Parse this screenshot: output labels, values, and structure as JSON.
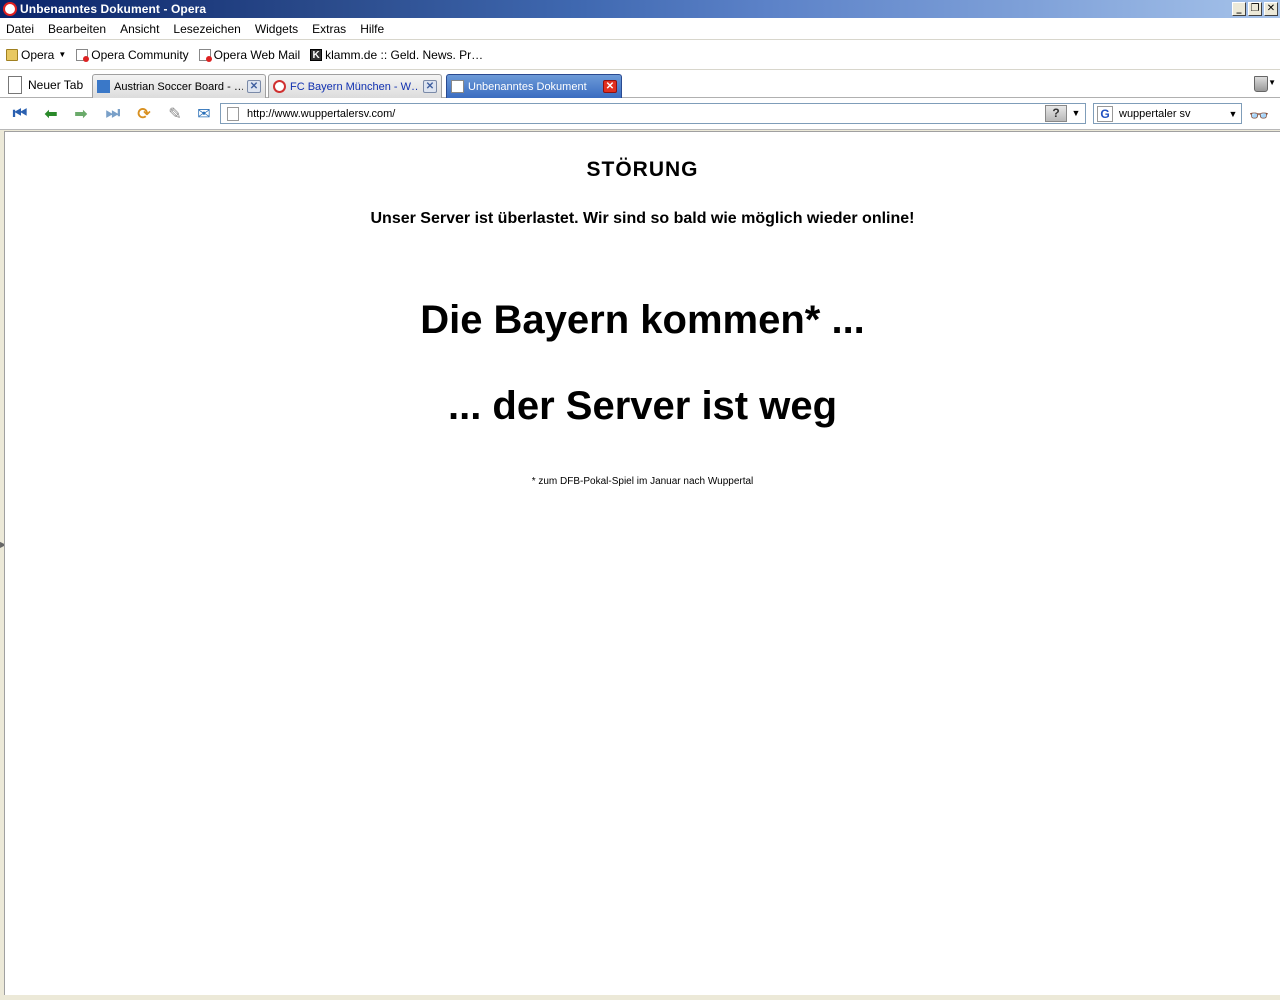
{
  "window": {
    "title": "Unbenanntes Dokument - Opera",
    "controls": {
      "minimize": "_",
      "restore": "❐",
      "close": "✕"
    }
  },
  "menubar": {
    "items": [
      "Datei",
      "Bearbeiten",
      "Ansicht",
      "Lesezeichen",
      "Widgets",
      "Extras",
      "Hilfe"
    ]
  },
  "bookmarks": {
    "items": [
      {
        "label": "Opera",
        "icon": "folder-icon"
      },
      {
        "label": "Opera Community",
        "icon": "opera-page-icon"
      },
      {
        "label": "Opera Web Mail",
        "icon": "opera-page-icon"
      },
      {
        "label": "klamm.de :: Geld. News. Pr…",
        "icon": "klamm-k-icon"
      }
    ]
  },
  "tabs": {
    "new_tab_label": "Neuer Tab",
    "items": [
      {
        "label": "Austrian Soccer Board - …",
        "active": false
      },
      {
        "label": "FC Bayern München - W…",
        "active": false
      },
      {
        "label": "Unbenanntes Dokument",
        "active": true
      }
    ]
  },
  "navbar": {
    "address_url": "http://www.wuppertalersv.com/",
    "search_value": "wuppertaler sv",
    "search_engine_letter": "G"
  },
  "page": {
    "heading": "STÖRUNG",
    "message": "Unser Server ist überlastet. Wir sind so bald wie möglich wieder online!",
    "line1": "Die Bayern kommen* ...",
    "line2": "... der Server ist weg",
    "footnote": "* zum DFB-Pokal-Spiel im Januar nach Wuppertal"
  },
  "colors": {
    "titlebar_start": "#0a246a",
    "active_tab": "#3a6cc0",
    "close_red": "#e03020"
  }
}
